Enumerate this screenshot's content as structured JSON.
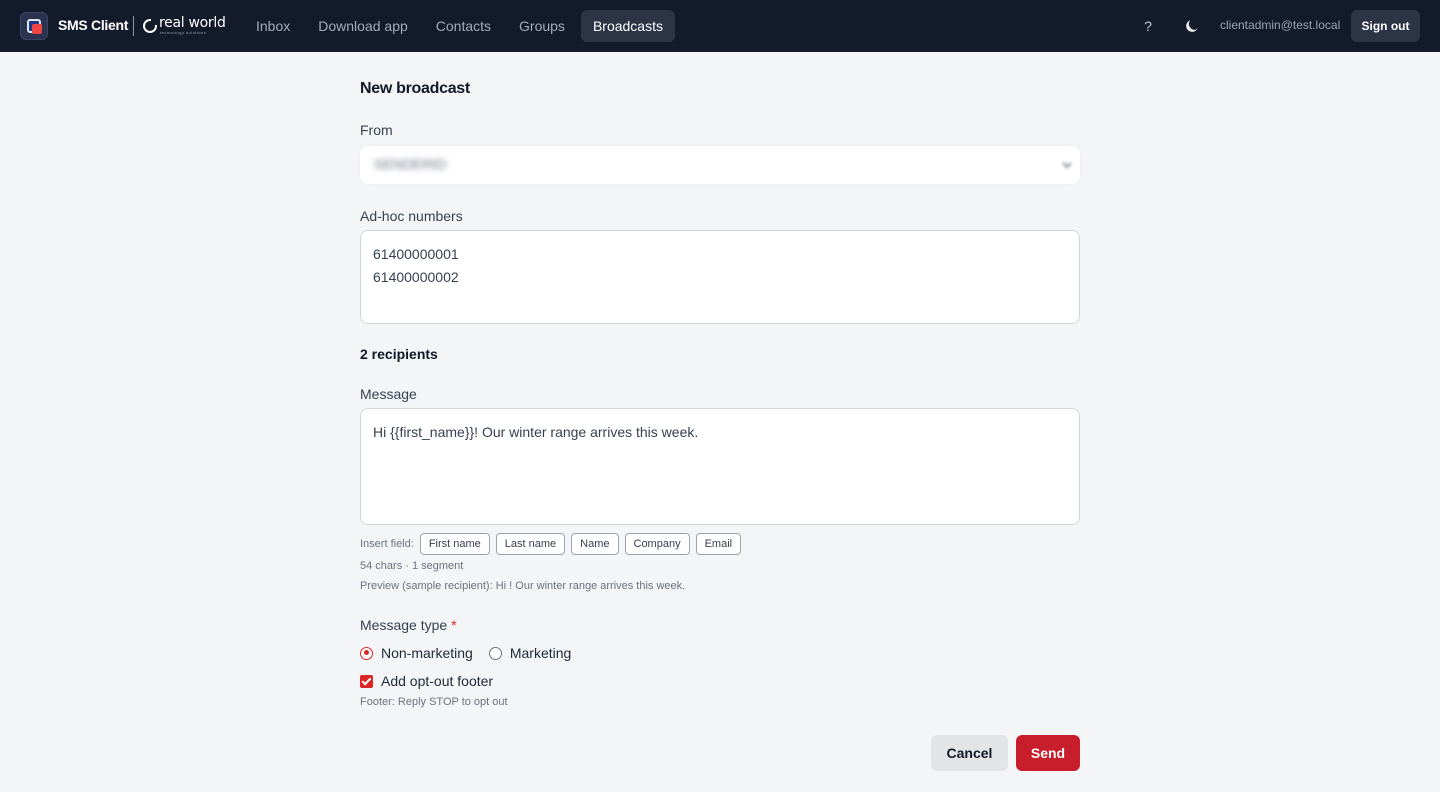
{
  "header": {
    "app_title": "SMS Client",
    "brand_name": "real world",
    "brand_tagline": "technology solutions",
    "nav": [
      {
        "label": "Inbox"
      },
      {
        "label": "Download app"
      },
      {
        "label": "Contacts"
      },
      {
        "label": "Groups"
      },
      {
        "label": "Broadcasts",
        "active": true
      }
    ],
    "help_label": "?",
    "theme_icon": "moon-icon",
    "user_email": "clientadmin@test.local",
    "sign_out_label": "Sign out"
  },
  "form": {
    "title": "New broadcast",
    "from": {
      "label": "From",
      "value": "SENDERID"
    },
    "adhoc": {
      "label": "Ad-hoc numbers",
      "value": "61400000001\n61400000002"
    },
    "recipients_text": "2 recipients",
    "message": {
      "label": "Message",
      "value": "Hi {{first_name}}! Our winter range arrives this week."
    },
    "insert_field": {
      "label": "Insert field:",
      "chips": [
        "First name",
        "Last name",
        "Name",
        "Company",
        "Email"
      ]
    },
    "char_count": "54 chars · 1 segment",
    "preview": "Preview (sample recipient): Hi ! Our winter range arrives this week.",
    "message_type": {
      "label": "Message type",
      "required_mark": "*",
      "options": [
        {
          "label": "Non-marketing",
          "selected": true
        },
        {
          "label": "Marketing",
          "selected": false
        }
      ]
    },
    "opt_out": {
      "label": "Add opt-out footer",
      "checked": true,
      "footer_note": "Footer: Reply STOP to opt out"
    },
    "cancel_label": "Cancel",
    "send_label": "Send"
  },
  "colors": {
    "nav_background": "#131a2a",
    "accent": "#c81e2b",
    "page_background": "#f4f5f7"
  }
}
